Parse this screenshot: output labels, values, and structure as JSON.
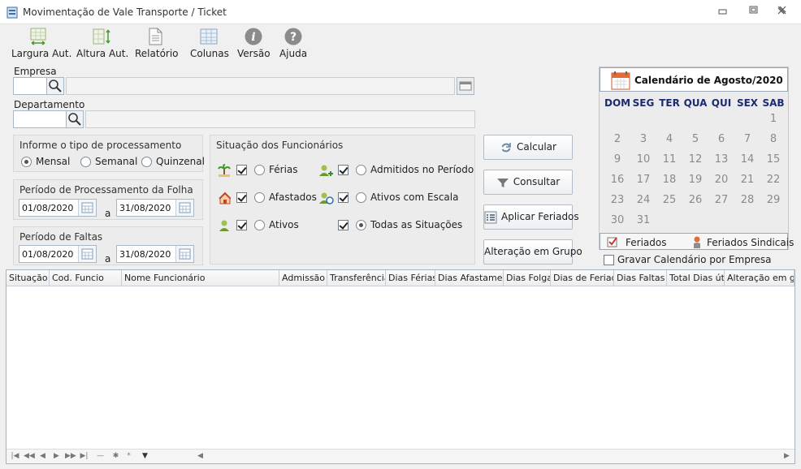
{
  "window": {
    "title": "Movimentação de Vale Transporte / Ticket"
  },
  "toolbar": {
    "items": [
      {
        "label": "Largura Aut.",
        "icon": "width-auto-icon"
      },
      {
        "label": "Altura Aut.",
        "icon": "height-auto-icon"
      },
      {
        "label": "Relatório",
        "icon": "report-icon"
      },
      {
        "label": "Colunas",
        "icon": "columns-icon"
      },
      {
        "label": "Versão",
        "icon": "info-icon"
      },
      {
        "label": "Ajuda",
        "icon": "help-icon"
      }
    ]
  },
  "empresa": {
    "label": "Empresa",
    "code": "",
    "name": ""
  },
  "departamento": {
    "label": "Departamento",
    "code": "",
    "name": ""
  },
  "tipo_processamento": {
    "title": "Informe o tipo de processamento",
    "options": [
      "Mensal",
      "Semanal",
      "Quinzenal"
    ],
    "selected": "Mensal"
  },
  "periodo_folha": {
    "title": "Período de Processamento da Folha",
    "start": "01/08/2020",
    "sep": "a",
    "end": "31/08/2020"
  },
  "periodo_faltas": {
    "title": "Período de Faltas",
    "start": "01/08/2020",
    "sep": "a",
    "end": "31/08/2020"
  },
  "situacao": {
    "title": "Situação dos Funcionários",
    "left": [
      {
        "label": "Férias",
        "checked": true
      },
      {
        "label": "Afastados",
        "checked": true
      },
      {
        "label": "Ativos",
        "checked": true
      }
    ],
    "right": [
      {
        "label": "Admitidos no Período",
        "checked": true
      },
      {
        "label": "Ativos com Escala",
        "checked": true
      },
      {
        "label": "Todas as Situações",
        "checked": true
      }
    ],
    "selected": "Todas as Situações"
  },
  "actions": {
    "calcular": "Calcular",
    "consultar": "Consultar",
    "aplicar_feriados": "Aplicar Feriados",
    "alteracao_grupo": "Alteração em Grupo"
  },
  "calendar": {
    "title": "Calendário de Agosto/2020",
    "weekdays": [
      "DOM",
      "SEG",
      "TER",
      "QUA",
      "QUI",
      "SEX",
      "SAB"
    ],
    "weeks": [
      [
        "",
        "",
        "",
        "",
        "",
        "",
        "1"
      ],
      [
        "2",
        "3",
        "4",
        "5",
        "6",
        "7",
        "8"
      ],
      [
        "9",
        "10",
        "11",
        "12",
        "13",
        "14",
        "15"
      ],
      [
        "16",
        "17",
        "18",
        "19",
        "20",
        "21",
        "22"
      ],
      [
        "23",
        "24",
        "25",
        "26",
        "27",
        "28",
        "29"
      ],
      [
        "30",
        "31",
        "",
        "",
        "",
        "",
        ""
      ]
    ],
    "legend_feriados": "Feriados",
    "legend_sindicais": "Feriados Sindicais",
    "gravar_label": "Gravar Calendário por Empresa",
    "gravar_checked": false
  },
  "grid": {
    "columns": [
      "Situação",
      "Cod. Funcio",
      "Nome Funcionário",
      "Admissão",
      "Transferência",
      "Dias Férias",
      "Dias Afastamento",
      "Dias Folga",
      "Dias de Feriado",
      "Dias Faltas",
      "Total Dias úteis",
      "Alteração em grupo"
    ],
    "rows": []
  },
  "colors": {
    "accent": "#1c2c6e",
    "check_red": "#d9342b"
  }
}
